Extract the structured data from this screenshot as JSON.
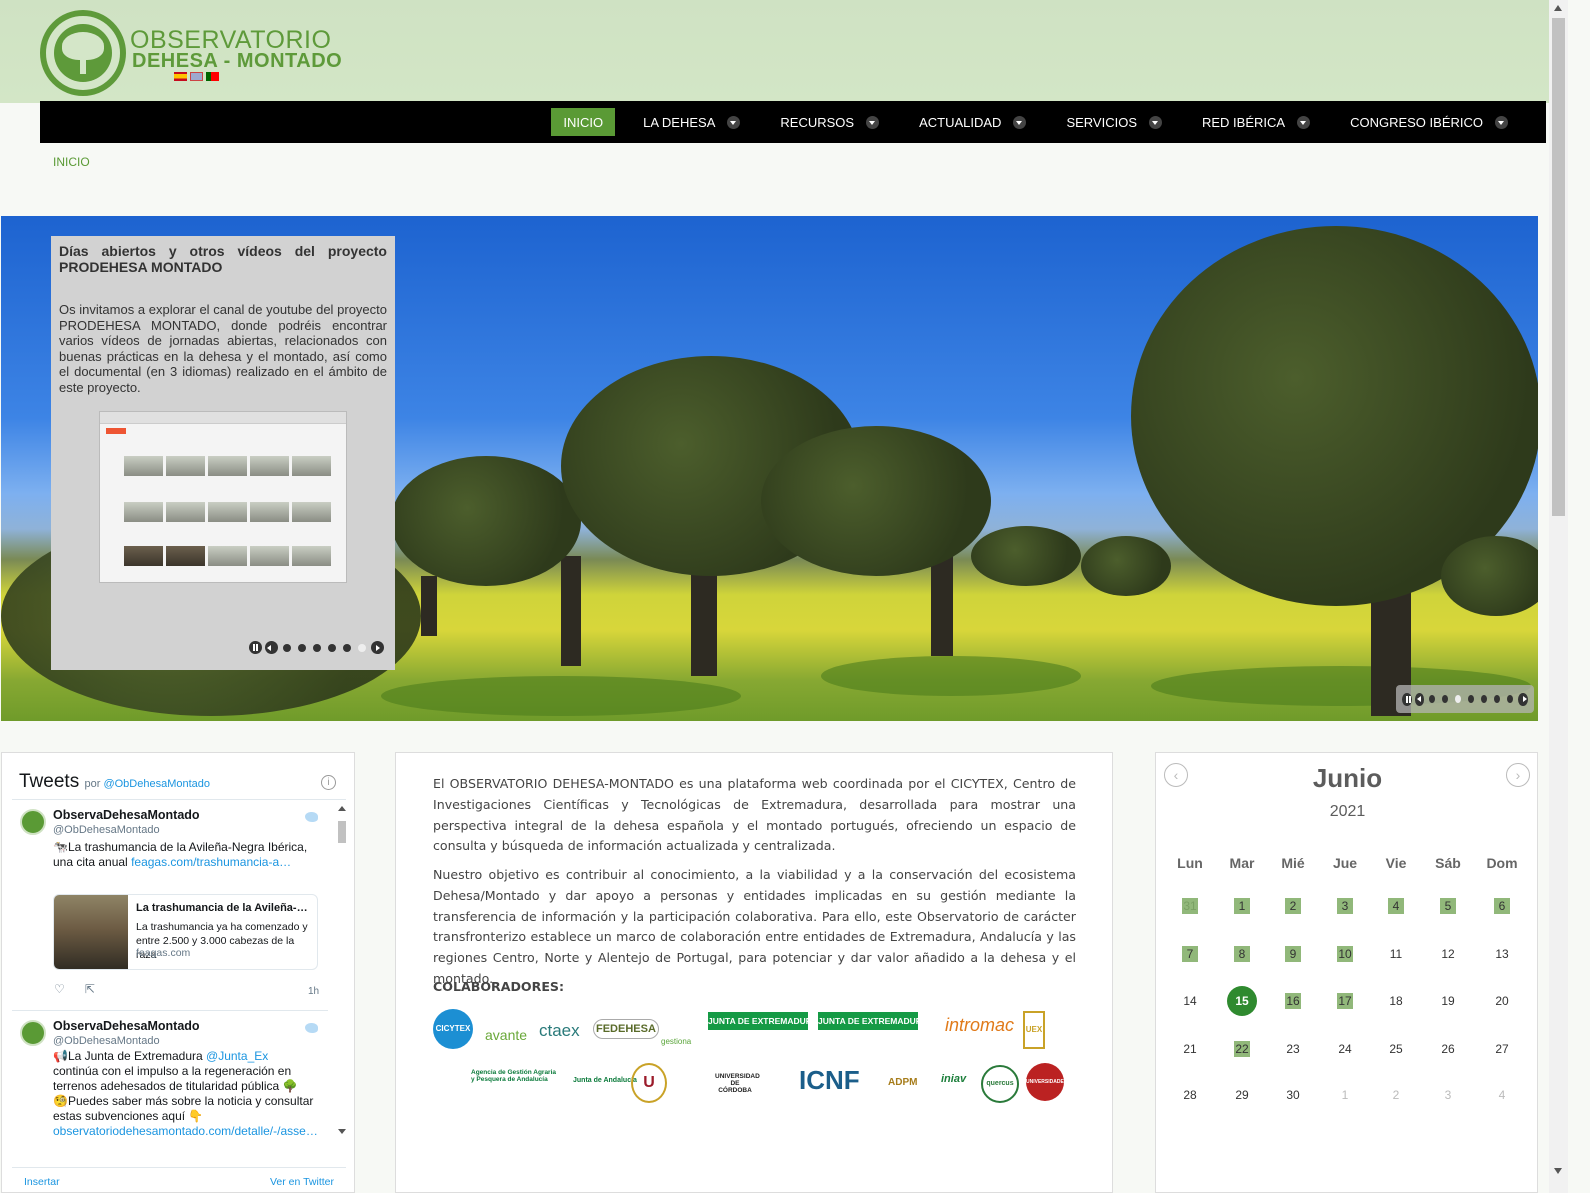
{
  "header": {
    "logo_line1": "OBSERVATORIO",
    "logo_line2": "DEHESA - MONTADO",
    "languages": [
      "es-flag-icon",
      "uk-flag-icon",
      "pt-flag-icon"
    ]
  },
  "nav": {
    "items": [
      {
        "label": "INICIO",
        "active": true,
        "dropdown": false
      },
      {
        "label": "LA DEHESA",
        "dropdown": true
      },
      {
        "label": "RECURSOS",
        "dropdown": true
      },
      {
        "label": "ACTUALIDAD",
        "dropdown": true
      },
      {
        "label": "SERVICIOS",
        "dropdown": true
      },
      {
        "label": "RED IBÉRICA",
        "dropdown": true
      },
      {
        "label": "CONGRESO IBÉRICO",
        "dropdown": true
      }
    ]
  },
  "breadcrumb": "INICIO",
  "slider": {
    "title": "Días abiertos y otros vídeos del proyecto PRODEHESA MONTADO",
    "text": "Os invitamos a explorar el canal de youtube del proyecto PRODEHESA MONTADO, donde podréis encontrar varios vídeos de jornadas abiertas, relacionados con buenas prácticas en la dehesa y el montado, así como el documental (en 3 idiomas) realizado en el ámbito de este proyecto.",
    "inner_dots": 6,
    "inner_active_dot": 5,
    "main_dots": 7,
    "main_active_dot": 2
  },
  "twitter": {
    "title": "Tweets",
    "by": "por",
    "by_handle": "@ObDehesaMontado",
    "tweets": [
      {
        "name": "ObservaDehesaMontado",
        "handle": "@ObDehesaMontado",
        "text": "🐄La trashumancia de la Avileña-Negra Ibérica, una cita anual ",
        "link": "feagas.com/trashumancia-a…",
        "card_title": "La trashumancia de la Avileña-Negra Ibérica, una cita anual",
        "card_desc": "La trashumancia ya ha comenzado y entre 2.500 y 3.000 cabezas de la raza",
        "card_domain": "feagas.com",
        "time": "1h"
      },
      {
        "name": "ObservaDehesaMontado",
        "handle": "@ObDehesaMontado",
        "text_a": "📢La Junta de Extremadura ",
        "mention": "@Junta_Ex",
        "text_b": " continúa con el impulso a la regeneración en terrenos adehesados de titularidad pública 🌳",
        "text_c": "🧐Puedes saber más sobre la noticia y consultar estas subvenciones aquí 👇",
        "link": "observatoriodehesamontado.com/detalle/-/asse…"
      }
    ],
    "footer_left": "Insertar",
    "footer_right": "Ver en Twitter"
  },
  "main": {
    "p1": "El OBSERVATORIO DEHESA-MONTADO es una plataforma web coordinada por el CICYTEX, Centro de Investigaciones Científicas y Tecnológicas de Extremadura, desarrollada para mostrar una perspectiva integral de la dehesa española y el montado portugués, ofreciendo un espacio de consulta y búsqueda de información actualizada y centralizada.",
    "p2": "Nuestro objetivo es contribuir al conocimiento, a la viabilidad y a la conservación del ecosistema Dehesa/Montado y dar apoyo a personas y entidades implicadas en su gestión mediante la transferencia de información y la participación colaborativa. Para ello, este Observatorio de carácter transfronterizo establece un marco de colaboración entre entidades de Extremadura, Andalucía y las regiones Centro, Norte y Alentejo de Portugal, para potenciar y dar valor añadido a la dehesa y el montado.",
    "collab_title": "COLABORADORES:",
    "logos": {
      "cicytex": "CICYTEX",
      "avante": "avante",
      "ctaex": "ctaex",
      "fedehesa": "FEDEHESA",
      "gestiona": "gestiona",
      "junta1": "JUNTA DE EXTREMADURA",
      "junta2": "JUNTA DE EXTREMADURA",
      "intromac": "intromac",
      "uex": "UEX",
      "agapa": "Agencia de Gestión Agraria y Pesquera de Andalucía",
      "junta_andalucia": "Junta de Andalucía",
      "uco": "UNIVERSIDAD DE CÓRDOBA",
      "icnf": "ICNF",
      "adpm": "ADPM",
      "iniav": "iniav",
      "quercus": "quercus",
      "evora": "UNIVERSIDADE DE ÉVORA"
    }
  },
  "calendar": {
    "month": "Junio",
    "year": "2021",
    "prev_icon": "chevron-left-icon",
    "next_icon": "chevron-right-icon",
    "dows": [
      "Lun",
      "Mar",
      "Mié",
      "Jue",
      "Vie",
      "Sáb",
      "Dom"
    ],
    "weeks": [
      [
        {
          "d": "31",
          "o": true,
          "e": true
        },
        {
          "d": "1",
          "e": true
        },
        {
          "d": "2",
          "e": true
        },
        {
          "d": "3",
          "e": true
        },
        {
          "d": "4",
          "e": true
        },
        {
          "d": "5",
          "e": true
        },
        {
          "d": "6",
          "e": true
        }
      ],
      [
        {
          "d": "7",
          "e": true
        },
        {
          "d": "8",
          "e": true
        },
        {
          "d": "9",
          "e": true
        },
        {
          "d": "10",
          "e": true
        },
        {
          "d": "11"
        },
        {
          "d": "12"
        },
        {
          "d": "13"
        }
      ],
      [
        {
          "d": "14"
        },
        {
          "d": "15",
          "t": true
        },
        {
          "d": "16",
          "e": true
        },
        {
          "d": "17",
          "e": true
        },
        {
          "d": "18"
        },
        {
          "d": "19"
        },
        {
          "d": "20"
        }
      ],
      [
        {
          "d": "21"
        },
        {
          "d": "22",
          "e": true
        },
        {
          "d": "23"
        },
        {
          "d": "24"
        },
        {
          "d": "25"
        },
        {
          "d": "26"
        },
        {
          "d": "27"
        }
      ],
      [
        {
          "d": "28"
        },
        {
          "d": "29"
        },
        {
          "d": "30"
        },
        {
          "d": "1",
          "o": true
        },
        {
          "d": "2",
          "o": true
        },
        {
          "d": "3",
          "o": true
        },
        {
          "d": "4",
          "o": true
        }
      ]
    ]
  },
  "colors": {
    "brand_green": "#5a9a35",
    "header_bg": "#cfe2c3",
    "nav_bg": "#000000",
    "event_day": "#91b87a",
    "today": "#2f8a2f"
  }
}
